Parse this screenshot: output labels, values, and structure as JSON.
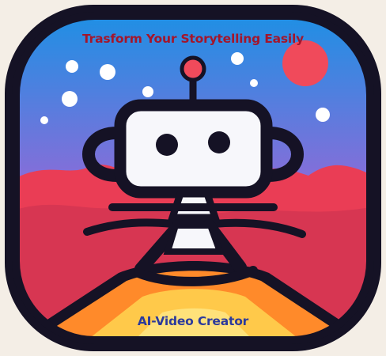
{
  "icon": {
    "tagline": "Trasform Your Storytelling Easily",
    "app_name": "AI-Video Creator",
    "subject": "robot-mascot",
    "colors": {
      "outline": "#151225",
      "sky_top": "#1f8fe4",
      "sky_mid": "#8f6bd8",
      "sky_bottom": "#f0457c",
      "mountains": "#ea3d55",
      "mountains_shade": "#c73250",
      "hill_orange": "#ff8a2a",
      "hill_yellow": "#ffc94a",
      "planet": "#f04a5b",
      "robot_face": "#f7f7fb",
      "tagline_text": "#a3162c",
      "app_name_text": "#2b3a9c"
    }
  }
}
